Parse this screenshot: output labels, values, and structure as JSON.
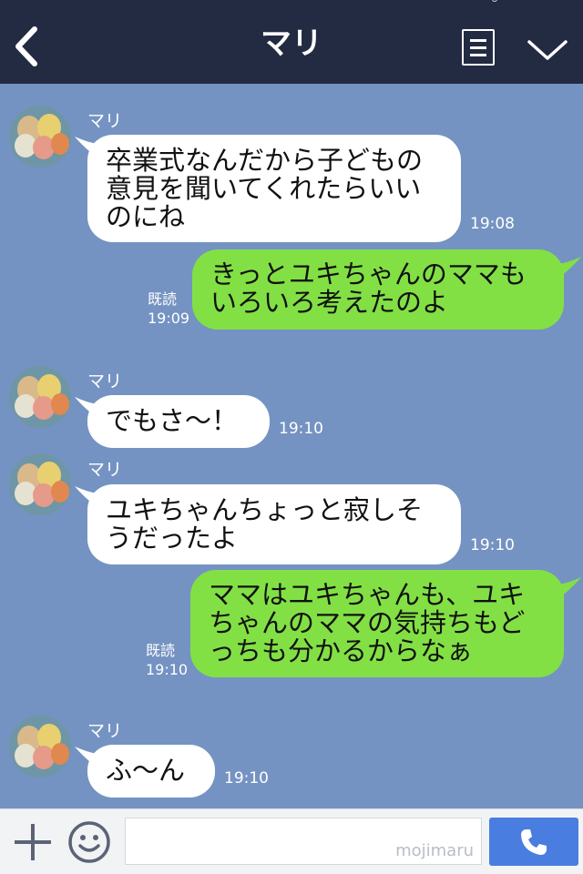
{
  "header": {
    "title": "マリ"
  },
  "contact": {
    "name": "マリ"
  },
  "messages": [
    {
      "side": "in",
      "text": "卒業式なんだから子どもの\n意見を聞いてくれたらいい\nのにね",
      "time": "19:08"
    },
    {
      "side": "out",
      "text": "きっとユキちゃんのママも\nいろいろ考えたのよ",
      "read": "既読",
      "time": "19:09"
    },
    {
      "side": "in",
      "text": "でもさ〜！",
      "time": "19:10"
    },
    {
      "side": "in",
      "text": "ユキちゃんちょっと寂しそ\nうだったよ",
      "time": "19:10"
    },
    {
      "side": "out",
      "text": "ママはユキちゃんも、ユキ\nちゃんのママの気持ちもど\nっちも分かるからなぁ",
      "read": "既読",
      "time": "19:10"
    },
    {
      "side": "in",
      "text": "ふ〜ん",
      "time": "19:10"
    }
  ],
  "input": {
    "watermark": "mojimaru"
  },
  "icons": {
    "back": "chevron-left-icon",
    "menu": "notes-icon",
    "dropdown": "chevron-down-icon",
    "plus": "plus-icon",
    "emoji": "smiley-icon",
    "call": "phone-icon"
  },
  "colors": {
    "header_bg": "#232b42",
    "chat_bg": "#7493c2",
    "incoming_bubble": "#ffffff",
    "outgoing_bubble": "#82e045",
    "call_button": "#4a7de0"
  }
}
